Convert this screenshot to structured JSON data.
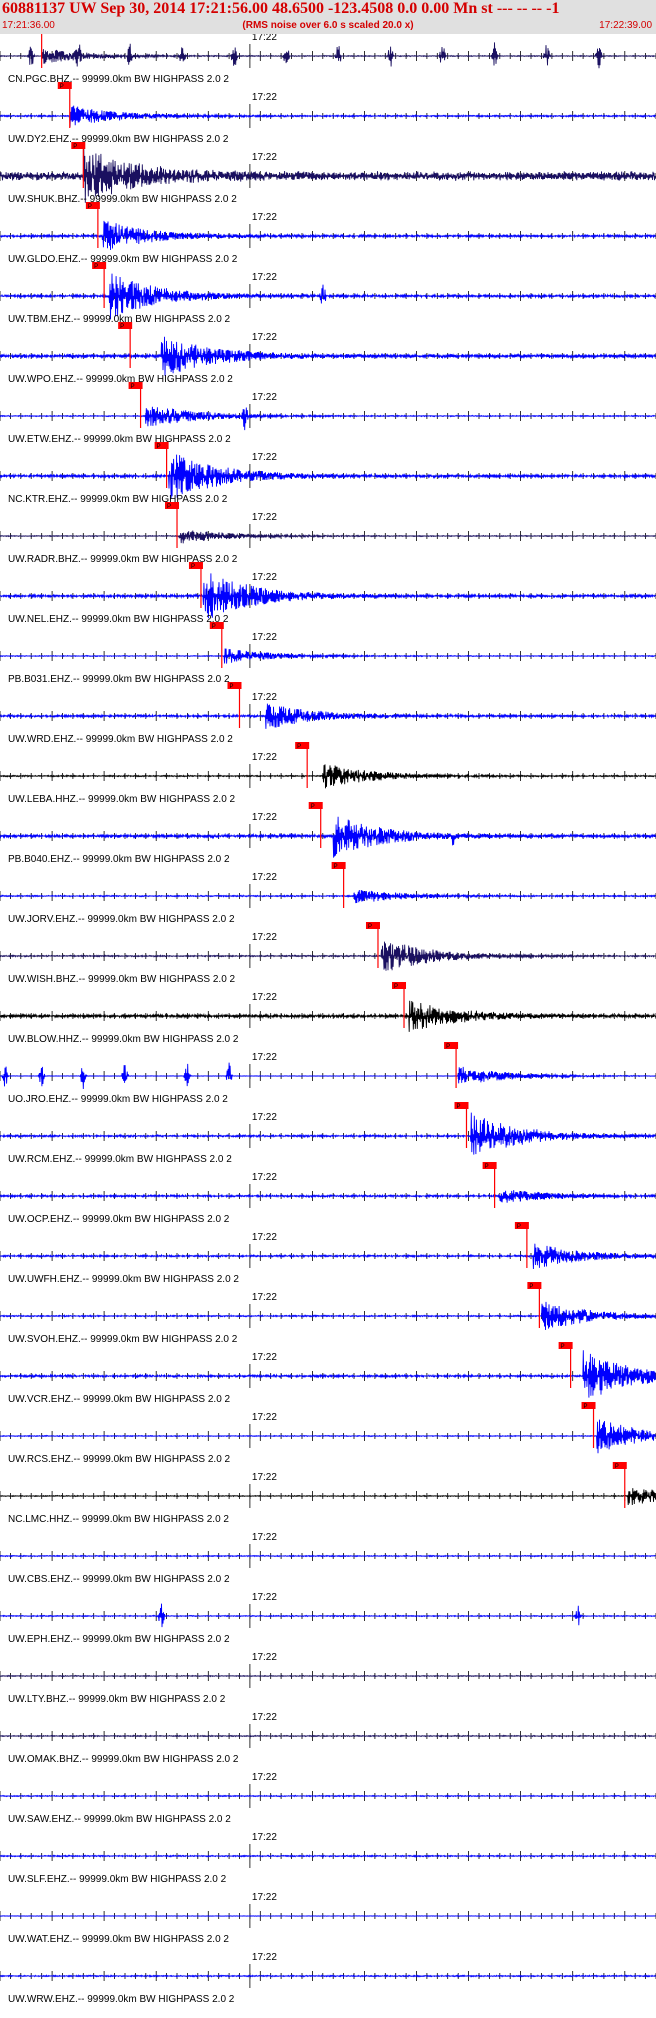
{
  "header": {
    "title": "60881137 UW Sep 30, 2014 17:21:56.00   48.6500 -123.4508  0.0 0.00 Mn st --- -- --  -1",
    "start_time": "17:21:36.00",
    "subtitle": "(RMS noise over 6.0 s scaled 20.0 x)",
    "end_time": "17:22:39.00"
  },
  "colors": {
    "header_bg": "#e0e0e0",
    "title_text": "#d40000",
    "trace_blue": "#0000ff",
    "trace_navy": "#1a1060",
    "trace_black": "#000000",
    "pick": "#ff0000",
    "label_text": "#000000"
  },
  "chart_data": {
    "type": "line",
    "title": "60881137 UW Sep 30, 2014 17:21:56.00   48.6500 -123.4508  0.0 0.00 Mn st --- -- --  -1",
    "xlabel": "",
    "ylabel": "",
    "xlim": [
      "17:21:36.00",
      "17:22:39.00"
    ],
    "time_marker": "17:22",
    "pick_label": "P",
    "traces": [
      {
        "label": "CN.PGC.BHZ.-- 99999.0km BW  HIGHPASS  2.0  2",
        "color": "navy",
        "noise": 0.1,
        "pick_seconds": 4.0,
        "event_seconds": 4.0,
        "event_amp": 0.3,
        "spikes": [
          3,
          7.5,
          12.5,
          17.5,
          22.5,
          27.5,
          32.5,
          37.5,
          42.5,
          47.5,
          52.5,
          57.5
        ]
      },
      {
        "label": "UW.DY2.EHZ.-- 99999.0km BW  HIGHPASS  2.0  2",
        "color": "blue",
        "noise": 0.18,
        "pick_seconds": 6.7,
        "event_seconds": 6.7,
        "event_amp": 0.4,
        "spikes": []
      },
      {
        "label": "UW.SHUK.BHZ.-- 99999.0km BW  HIGHPASS  2.0  2",
        "color": "navy",
        "noise": 1.0,
        "pick_seconds": 8.0,
        "event_seconds": 8.0,
        "event_amp": 1.0,
        "spikes": []
      },
      {
        "label": "UW.GLDO.EHZ.-- 99999.0km BW  HIGHPASS  2.0  2",
        "color": "blue",
        "noise": 0.25,
        "pick_seconds": 9.4,
        "event_seconds": 9.8,
        "event_amp": 0.6,
        "spikes": []
      },
      {
        "label": "UW.TBM.EHZ.-- 99999.0km BW  HIGHPASS  2.0  2",
        "color": "blue",
        "noise": 0.28,
        "pick_seconds": 10.0,
        "event_seconds": 10.5,
        "event_amp": 0.9,
        "spikes": [
          31
        ]
      },
      {
        "label": "UW.WPO.EHZ.-- 99999.0km BW  HIGHPASS  2.0  2",
        "color": "blue",
        "noise": 0.4,
        "pick_seconds": 12.5,
        "event_seconds": 15.5,
        "event_amp": 0.8,
        "spikes": []
      },
      {
        "label": "UW.ETW.EHZ.-- 99999.0km BW  HIGHPASS  2.0  2",
        "color": "blue",
        "noise": 0.12,
        "pick_seconds": 13.5,
        "event_seconds": 14.0,
        "event_amp": 0.5,
        "spikes": [
          23.5
        ]
      },
      {
        "label": "NC.KTR.EHZ.-- 99999.0km BW  HIGHPASS  2.0  2",
        "color": "blue",
        "noise": 0.3,
        "pick_seconds": 16.0,
        "event_seconds": 16.2,
        "event_amp": 1.0,
        "spikes": []
      },
      {
        "label": "UW.RADR.BHZ.-- 99999.0km BW  HIGHPASS  2.0  2",
        "color": "navy",
        "noise": 0.1,
        "pick_seconds": 17.0,
        "event_seconds": 17.2,
        "event_amp": 0.3,
        "spikes": []
      },
      {
        "label": "UW.NEL.EHZ.-- 99999.0km BW  HIGHPASS  2.0  2",
        "color": "blue",
        "noise": 0.3,
        "pick_seconds": 19.3,
        "event_seconds": 19.5,
        "event_amp": 1.0,
        "spikes": []
      },
      {
        "label": "PB.B031.EHZ.-- 99999.0km BW  HIGHPASS  2.0  2",
        "color": "blue",
        "noise": 0.1,
        "pick_seconds": 21.3,
        "event_seconds": 21.5,
        "event_amp": 0.3,
        "spikes": []
      },
      {
        "label": "UW.WRD.EHZ.-- 99999.0km BW  HIGHPASS  2.0  2",
        "color": "blue",
        "noise": 0.25,
        "pick_seconds": 23.0,
        "event_seconds": 25.5,
        "event_amp": 0.5,
        "spikes": []
      },
      {
        "label": "UW.LEBA.HHZ.-- 99999.0km BW  HIGHPASS  2.0  2",
        "color": "black",
        "noise": 0.15,
        "pick_seconds": 29.5,
        "event_seconds": 31.0,
        "event_amp": 0.5,
        "spikes": []
      },
      {
        "label": "PB.B040.EHZ.-- 99999.0km BW  HIGHPASS  2.0  2",
        "color": "blue",
        "noise": 0.35,
        "pick_seconds": 30.8,
        "event_seconds": 32.0,
        "event_amp": 0.8,
        "spikes": [
          43.5
        ]
      },
      {
        "label": "UW.JORV.EHZ.-- 99999.0km BW  HIGHPASS  2.0  2",
        "color": "blue",
        "noise": 0.15,
        "pick_seconds": 33.0,
        "event_seconds": 34.0,
        "event_amp": 0.3,
        "spikes": []
      },
      {
        "label": "UW.WISH.BHZ.-- 99999.0km BW  HIGHPASS  2.0  2",
        "color": "navy",
        "noise": 0.15,
        "pick_seconds": 36.3,
        "event_seconds": 36.6,
        "event_amp": 0.7,
        "spikes": []
      },
      {
        "label": "UW.BLOW.HHZ.-- 99999.0km BW  HIGHPASS  2.0  2",
        "color": "black",
        "noise": 0.35,
        "pick_seconds": 38.8,
        "event_seconds": 39.3,
        "event_amp": 0.6,
        "spikes": []
      },
      {
        "label": "UO.JRO.EHZ.-- 99999.0km BW  HIGHPASS  2.0  2",
        "color": "blue",
        "noise": 0.05,
        "pick_seconds": 43.8,
        "event_seconds": 44.0,
        "event_amp": 0.4,
        "spikes": [
          0.5,
          4,
          8,
          12,
          18,
          22
        ]
      },
      {
        "label": "UW.RCM.EHZ.-- 99999.0km BW  HIGHPASS  2.0  2",
        "color": "blue",
        "noise": 0.22,
        "pick_seconds": 44.8,
        "event_seconds": 45.2,
        "event_amp": 0.9,
        "spikes": []
      },
      {
        "label": "UW.OCP.EHZ.-- 99999.0km BW  HIGHPASS  2.0  2",
        "color": "blue",
        "noise": 0.22,
        "pick_seconds": 47.5,
        "event_seconds": 48.0,
        "event_amp": 0.3,
        "spikes": []
      },
      {
        "label": "UW.UWFH.EHZ.-- 99999.0km BW  HIGHPASS  2.0  2",
        "color": "blue",
        "noise": 0.2,
        "pick_seconds": 50.6,
        "event_seconds": 51.2,
        "event_amp": 0.5,
        "spikes": []
      },
      {
        "label": "UW.SVOH.EHZ.-- 99999.0km BW  HIGHPASS  2.0  2",
        "color": "blue",
        "noise": 0.15,
        "pick_seconds": 51.8,
        "event_seconds": 52.0,
        "event_amp": 0.6,
        "spikes": []
      },
      {
        "label": "UW.VCR.EHZ.-- 99999.0km BW  HIGHPASS  2.0  2",
        "color": "blue",
        "noise": 0.25,
        "pick_seconds": 54.8,
        "event_seconds": 56.0,
        "event_amp": 1.0,
        "spikes": []
      },
      {
        "label": "UW.RCS.EHZ.-- 99999.0km BW  HIGHPASS  2.0  2",
        "color": "blue",
        "noise": 0.1,
        "pick_seconds": 57.0,
        "event_seconds": 57.3,
        "event_amp": 0.7,
        "spikes": []
      },
      {
        "label": "NC.LMC.HHZ.-- 99999.0km BW  HIGHPASS  2.0  2",
        "color": "black",
        "noise": 0.1,
        "pick_seconds": 60.0,
        "event_seconds": 60.3,
        "event_amp": 0.4,
        "spikes": []
      },
      {
        "label": "UW.CBS.EHZ.-- 99999.0km BW  HIGHPASS  2.0  2",
        "color": "blue",
        "noise": 0.12,
        "pick_seconds": null,
        "event_seconds": null,
        "event_amp": 0,
        "spikes": []
      },
      {
        "label": "UW.EPH.EHZ.-- 99999.0km BW  HIGHPASS  2.0  2",
        "color": "blue",
        "noise": 0.12,
        "pick_seconds": null,
        "event_seconds": null,
        "event_amp": 0,
        "spikes": [
          15.5,
          55.5
        ]
      },
      {
        "label": "UW.LTY.BHZ.-- 99999.0km BW  HIGHPASS  2.0  2",
        "color": "navy",
        "noise": 0.1,
        "pick_seconds": null,
        "event_seconds": null,
        "event_amp": 0,
        "spikes": []
      },
      {
        "label": "UW.OMAK.BHZ.-- 99999.0km BW  HIGHPASS  2.0  2",
        "color": "navy",
        "noise": 0.12,
        "pick_seconds": null,
        "event_seconds": null,
        "event_amp": 0,
        "spikes": []
      },
      {
        "label": "UW.SAW.EHZ.-- 99999.0km BW  HIGHPASS  2.0  2",
        "color": "blue",
        "noise": 0.12,
        "pick_seconds": null,
        "event_seconds": null,
        "event_amp": 0,
        "spikes": []
      },
      {
        "label": "UW.SLF.EHZ.-- 99999.0km BW  HIGHPASS  2.0  2",
        "color": "blue",
        "noise": 0.15,
        "pick_seconds": null,
        "event_seconds": null,
        "event_amp": 0,
        "spikes": []
      },
      {
        "label": "UW.WAT.EHZ.-- 99999.0km BW  HIGHPASS  2.0  2",
        "color": "blue",
        "noise": 0.05,
        "pick_seconds": null,
        "event_seconds": null,
        "event_amp": 0,
        "spikes": []
      },
      {
        "label": "UW.WRW.EHZ.-- 99999.0km BW  HIGHPASS  2.0  2",
        "color": "blue",
        "noise": 0.15,
        "pick_seconds": null,
        "event_seconds": null,
        "event_amp": 0,
        "spikes": []
      }
    ]
  }
}
